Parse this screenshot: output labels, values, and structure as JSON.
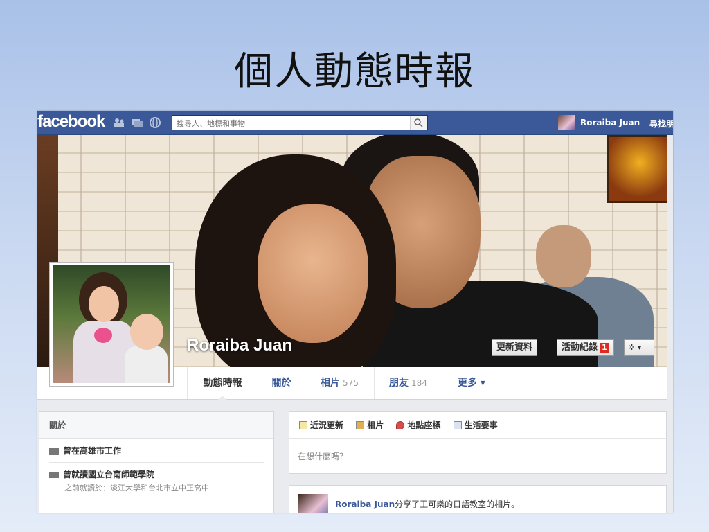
{
  "slide": {
    "title": "個人動態時報"
  },
  "topbar": {
    "logo": "facebook",
    "search_placeholder": "搜尋人、地標和事物",
    "user_name": "Roraiba Juan",
    "find_friends": "尋找朋友"
  },
  "profile": {
    "name": "Roraiba Juan",
    "update_info_label": "更新資料",
    "activity_log_label": "活動紀錄",
    "activity_badge": "1",
    "settings_label": "✲ ▾"
  },
  "tabs": [
    {
      "label": "動態時報",
      "count": ""
    },
    {
      "label": "關於",
      "count": ""
    },
    {
      "label": "相片",
      "count": "575"
    },
    {
      "label": "朋友",
      "count": "184"
    },
    {
      "label": "更多 ▾",
      "count": ""
    }
  ],
  "about": {
    "heading": "關於",
    "work": "曾在高雄市工作",
    "school": "曾就讀國立台南師範學院",
    "school_sub": "之前就讀於：淡江大學和台北市立中正高中"
  },
  "composer": {
    "tabs": [
      "近況更新",
      "相片",
      "地點座標",
      "生活要事"
    ],
    "placeholder": "在想什麼嗎？"
  },
  "story": {
    "user": "Roraiba Juan",
    "text": "分享了王可樂的日語教室的相片。"
  },
  "colors": {
    "fb_blue": "#3b5998",
    "badge_red": "#e02a1f"
  }
}
